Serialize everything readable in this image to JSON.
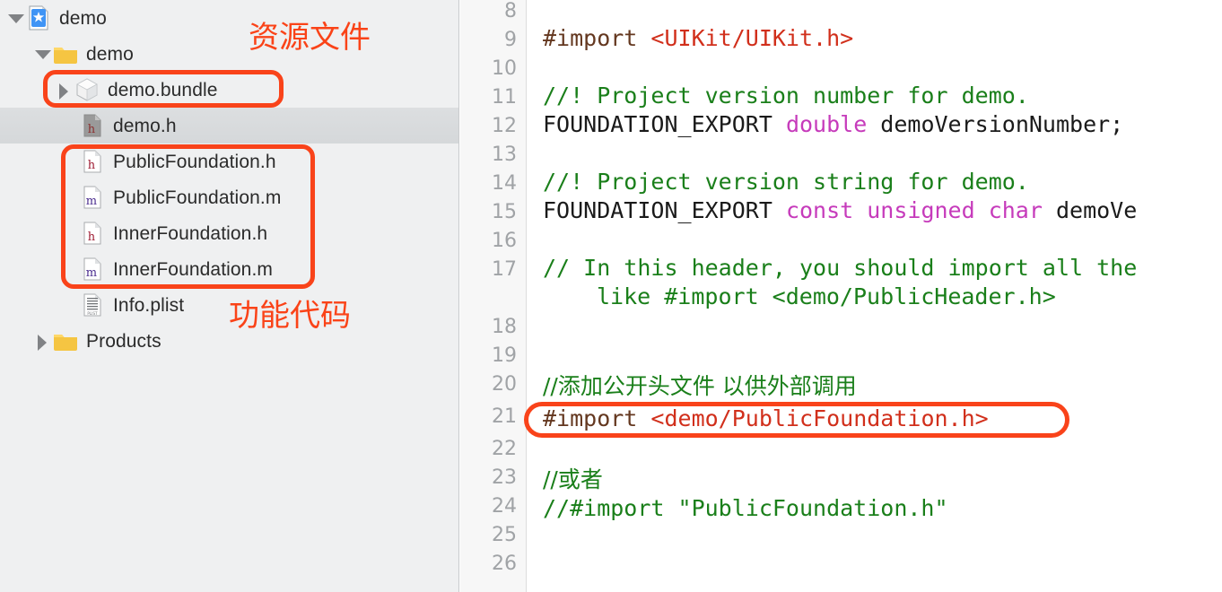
{
  "colors": {
    "annotation": "#FA4318",
    "sidebar_bg": "#EFF0F1",
    "selected_row": "#D8DBDD",
    "gutter_bg": "#F7F7F7",
    "comment": "#1A7F1A",
    "string": "#D12F1B",
    "keyword": "#C63BBB",
    "preprocessor": "#643820"
  },
  "navigator": {
    "rows": [
      {
        "label": "demo",
        "icon": "xcode-project-icon",
        "disclosure": "open",
        "indent": 0,
        "selected": false
      },
      {
        "label": "demo",
        "icon": "folder-icon",
        "disclosure": "open",
        "indent": 1,
        "selected": false
      },
      {
        "label": "demo.bundle",
        "icon": "bundle-icon",
        "disclosure": "closed",
        "indent": 2,
        "selected": false
      },
      {
        "label": "demo.h",
        "icon": "header-file-icon",
        "disclosure": "none",
        "indent": 3,
        "selected": true
      },
      {
        "label": "PublicFoundation.h",
        "icon": "header-file-icon",
        "disclosure": "none",
        "indent": 3,
        "selected": false
      },
      {
        "label": "PublicFoundation.m",
        "icon": "source-file-icon",
        "disclosure": "none",
        "indent": 3,
        "selected": false
      },
      {
        "label": "InnerFoundation.h",
        "icon": "header-file-icon",
        "disclosure": "none",
        "indent": 3,
        "selected": false
      },
      {
        "label": "InnerFoundation.m",
        "icon": "source-file-icon",
        "disclosure": "none",
        "indent": 3,
        "selected": false
      },
      {
        "label": "Info.plist",
        "icon": "plist-file-icon",
        "disclosure": "none",
        "indent": 3,
        "selected": false
      },
      {
        "label": "Products",
        "icon": "folder-icon",
        "disclosure": "closed",
        "indent": 1,
        "selected": false
      }
    ]
  },
  "annotations": {
    "resource_files": "资源文件",
    "feature_code": "功能代码"
  },
  "editor": {
    "line_numbers": [
      "8",
      "9",
      "10",
      "11",
      "12",
      "13",
      "14",
      "15",
      "16",
      "17",
      "18",
      "19",
      "20",
      "21",
      "22",
      "23",
      "24",
      "25",
      "26"
    ],
    "lines": {
      "l9_pre": "#import ",
      "l9_str": "<UIKit/UIKit.h>",
      "l11": "//! Project version number for demo.",
      "l12_pln1": "FOUNDATION_EXPORT ",
      "l12_kw": "double",
      "l12_pln2": " demoVersionNumber;",
      "l14": "//! Project version string for demo.",
      "l15_pln1": "FOUNDATION_EXPORT ",
      "l15_kw": "const unsigned char",
      "l15_pln2": " demoVe",
      "l17a": "// In this header, you should import all the",
      "l17b": "like #import <demo/PublicHeader.h>",
      "l20": "//添加公开头文件 以供外部调用",
      "l21_pre": "#import ",
      "l21_str": "<demo/PublicFoundation.h>",
      "l23": "//或者",
      "l24": "//#import \"PublicFoundation.h\""
    }
  }
}
